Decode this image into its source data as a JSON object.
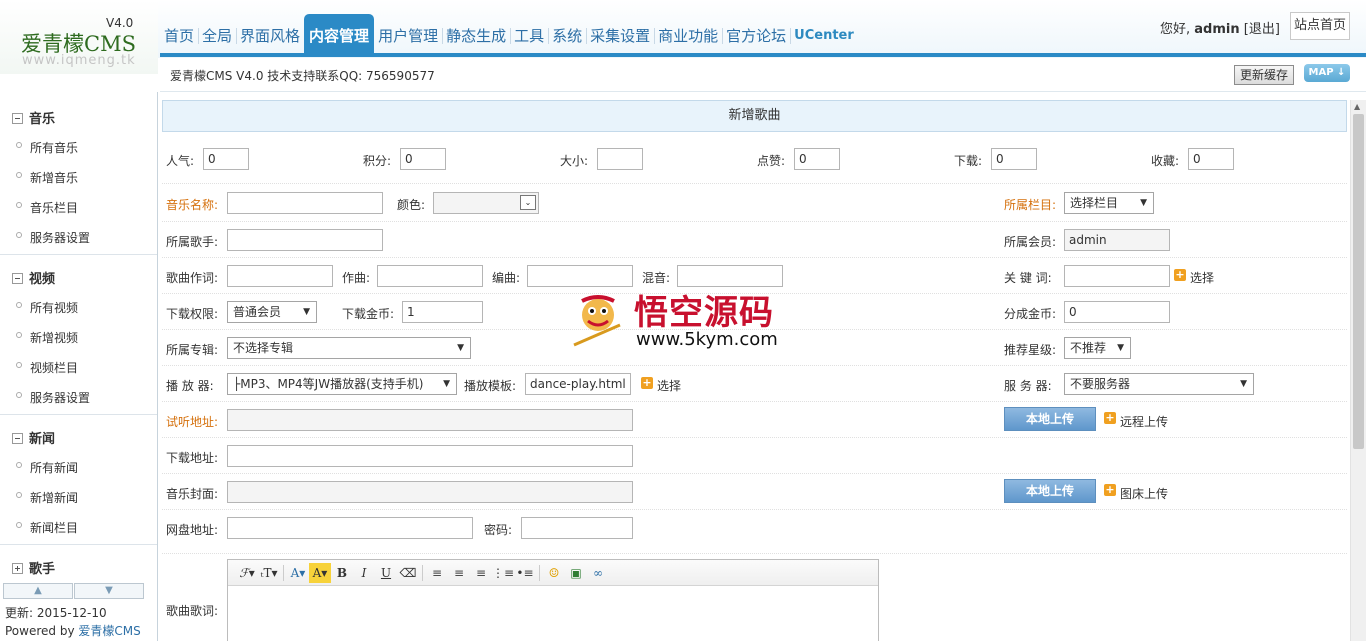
{
  "logo": {
    "brand": "爱青檬CMS",
    "version": "V4.0",
    "url": "www.iqmeng.tk"
  },
  "nav": [
    "首页",
    "全局",
    "界面风格",
    "内容管理",
    "用户管理",
    "静态生成",
    "工具",
    "系统",
    "采集设置",
    "商业功能",
    "官方论坛",
    "UCenter"
  ],
  "user": {
    "greeting": "您好,",
    "name": "admin",
    "logout": "[退出]",
    "home": "站点首页"
  },
  "infobar": {
    "text": "爱青檬CMS V4.0 技术支持联系QQ: 756590577",
    "cache": "更新缓存",
    "map": "MAP ↓"
  },
  "sidebar": {
    "groups": [
      {
        "title": "音乐",
        "items": [
          "所有音乐",
          "新增音乐",
          "音乐栏目",
          "服务器设置"
        ]
      },
      {
        "title": "视频",
        "items": [
          "所有视频",
          "新增视频",
          "视频栏目",
          "服务器设置"
        ]
      },
      {
        "title": "新闻",
        "items": [
          "所有新闻",
          "新增新闻",
          "新闻栏目"
        ]
      },
      {
        "title": "歌手",
        "items": []
      }
    ],
    "up": "▲",
    "down": "▼",
    "update": "更新: 2015-12-10",
    "powered_prefix": "Powered by ",
    "powered_name": "爱青檬CMS"
  },
  "form": {
    "title": "新增歌曲",
    "row1": [
      {
        "label": "人气:",
        "value": "0"
      },
      {
        "label": "积分:",
        "value": "0"
      },
      {
        "label": "大小:",
        "value": ""
      },
      {
        "label": "点赞:",
        "value": "0"
      },
      {
        "label": "下载:",
        "value": "0"
      },
      {
        "label": "收藏:",
        "value": "0"
      }
    ],
    "music_name_label": "音乐名称:",
    "color_label": "颜色:",
    "category_label": "所属栏目:",
    "category_value": "选择栏目",
    "singer_label": "所属歌手:",
    "member_label": "所属会员:",
    "member_value": "admin",
    "lyricist_label": "歌曲作词:",
    "composer_label": "作曲:",
    "arranger_label": "编曲:",
    "mixer_label": "混音:",
    "keyword_label": "关 键 词:",
    "select_label": "选择",
    "perm_label": "下载权限:",
    "perm_value": "普通会员",
    "coin_label": "下载金币:",
    "coin_value": "1",
    "share_label": "分成金币:",
    "share_value": "0",
    "album_label": "所属专辑:",
    "album_value": "不选择专辑",
    "star_label": "推荐星级:",
    "star_value": "不推荐",
    "player_label": "播 放 器:",
    "player_value": "├MP3、MP4等JW播放器(支持手机)",
    "template_label": "播放模板:",
    "template_value": "dance-play.html",
    "server_label": "服 务 器:",
    "server_value": "不要服务器",
    "preview_label": "试听地址:",
    "local_upload": "本地上传",
    "remote_upload": "远程上传",
    "download_label": "下载地址:",
    "cover_label": "音乐封面:",
    "image_upload": "图床上传",
    "netdisk_label": "网盘地址:",
    "password_label": "密码:",
    "lyrics_label": "歌曲歌词:"
  },
  "watermark": {
    "title": "悟空源码",
    "url": "www.5kym.com"
  }
}
